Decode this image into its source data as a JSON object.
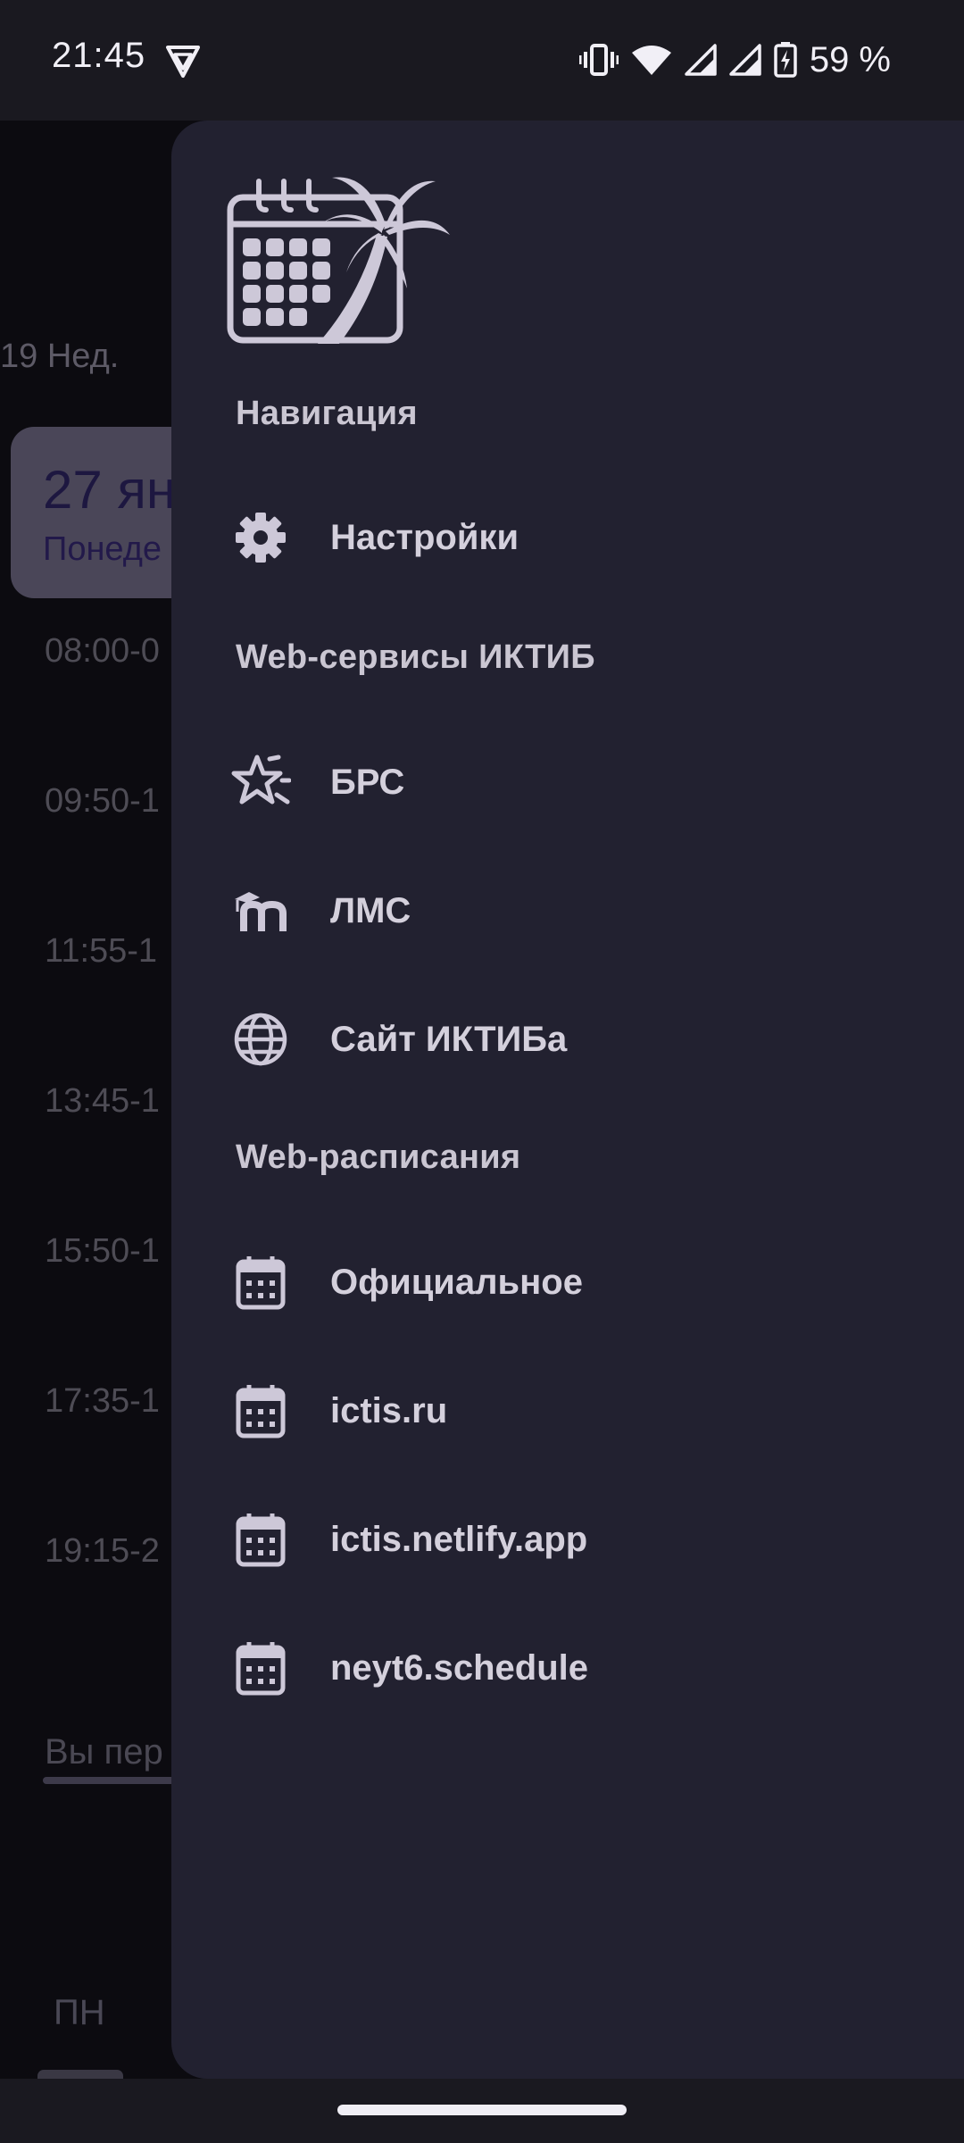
{
  "status_bar": {
    "time": "21:45",
    "battery_text": "59 %",
    "icons": [
      "vpn-shield-icon",
      "vibrate-icon",
      "wifi-icon",
      "signal-icon",
      "signal-icon",
      "battery-charging-icon"
    ]
  },
  "background": {
    "week_label": "19 Нед.",
    "day_card": {
      "date": "27 ян",
      "weekday": "Понеде"
    },
    "times": [
      "08:00-0",
      "09:50-1",
      "11:55-1",
      "13:45-1",
      "15:50-1",
      "17:35-1",
      "19:15-2"
    ],
    "link_text": "Вы пер",
    "bottom_day": "ПН"
  },
  "drawer": {
    "sections": [
      {
        "header": "Навигация",
        "items": [
          {
            "label": "Настройки",
            "icon": "gear-icon"
          }
        ]
      },
      {
        "header": "Web-сервисы ИКТИБ",
        "items": [
          {
            "label": "БРС",
            "icon": "star-icon"
          },
          {
            "label": "ЛМС",
            "icon": "moodle-icon"
          },
          {
            "label": "Сайт ИКТИБа",
            "icon": "globe-icon"
          }
        ]
      },
      {
        "header": "Web-расписания",
        "items": [
          {
            "label": "Официальное",
            "icon": "calendar-icon"
          },
          {
            "label": "ictis.ru",
            "icon": "calendar-icon"
          },
          {
            "label": "ictis.netlify.app",
            "icon": "calendar-icon"
          },
          {
            "label": "neyt6.schedule",
            "icon": "calendar-icon"
          }
        ]
      }
    ]
  },
  "colors": {
    "drawer_bg": "#222130",
    "icon": "#cdc8d8",
    "text": "#d4d0dc",
    "status_bar_bg": "#1a1920"
  }
}
